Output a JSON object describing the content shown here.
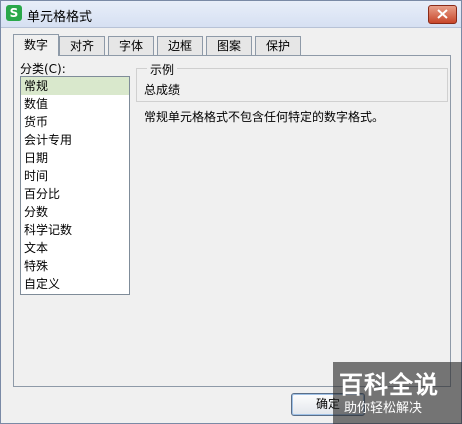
{
  "window": {
    "title": "单元格格式",
    "app_icon_letter": "S"
  },
  "tabs": [
    {
      "label": "数字",
      "active": true
    },
    {
      "label": "对齐",
      "active": false
    },
    {
      "label": "字体",
      "active": false
    },
    {
      "label": "边框",
      "active": false
    },
    {
      "label": "图案",
      "active": false
    },
    {
      "label": "保护",
      "active": false
    }
  ],
  "category": {
    "label": "分类(C):",
    "items": [
      "常规",
      "数值",
      "货币",
      "会计专用",
      "日期",
      "时间",
      "百分比",
      "分数",
      "科学记数",
      "文本",
      "特殊",
      "自定义"
    ],
    "selected": "常规"
  },
  "sample": {
    "legend": "示例",
    "value": "总成绩"
  },
  "description": "常规单元格格式不包含任何特定的数字格式。",
  "buttons": {
    "ok_label": "确定"
  },
  "watermark": {
    "title": "百科全说",
    "subtitle": "助你轻松解决"
  }
}
